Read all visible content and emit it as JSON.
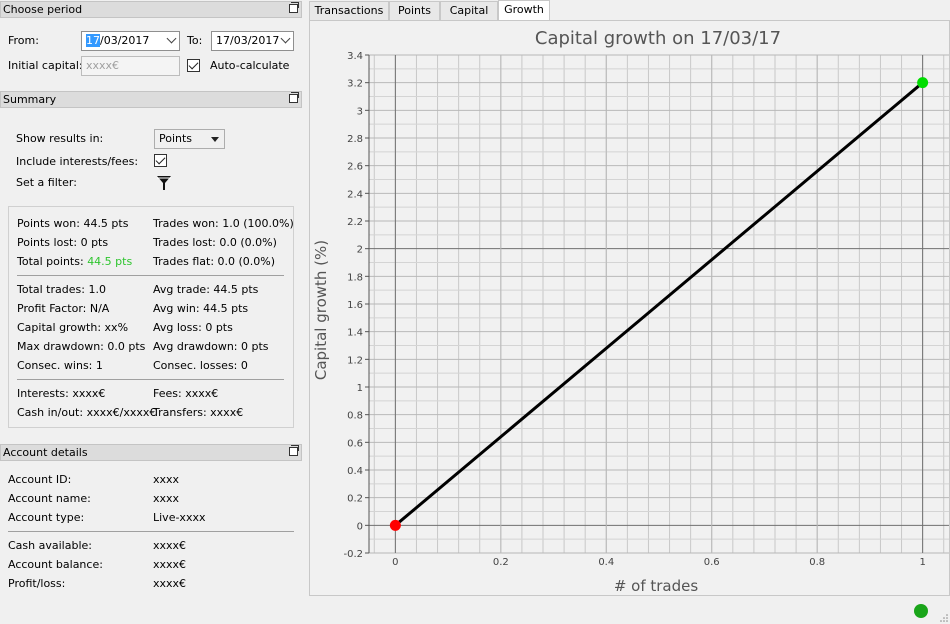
{
  "choose_period": {
    "header": "Choose period",
    "from_label": "From:",
    "from_value_day": "17",
    "from_value_rest": "/03/2017",
    "to_label": "To:",
    "to_value": "17/03/2017",
    "initial_capital_label": "Initial capital:",
    "initial_capital_placeholder": "xxxx€",
    "auto_calculate_label": "Auto-calculate",
    "auto_calculate_checked": true
  },
  "summary": {
    "header": "Summary",
    "show_results_label": "Show results in:",
    "show_results_value": "Points",
    "include_interests_label": "Include interests/fees:",
    "include_interests_checked": true,
    "filter_label": "Set a filter:",
    "stats_left": {
      "points_won": "Points won: 44.5 pts",
      "points_lost": "Points lost: 0 pts",
      "total_points_label": "Total points: ",
      "total_points_value": "44.5 pts",
      "total_trades": "Total trades: 1.0",
      "profit_factor": "Profit Factor: N/A",
      "capital_growth": "Capital growth: xx%",
      "max_drawdown": "Max drawdown: 0.0 pts",
      "consec_wins": "Consec. wins: 1",
      "interests": "Interests: xxxx€",
      "cash_in_out": "Cash in/out: xxxx€/xxxx€"
    },
    "stats_right": {
      "trades_won": "Trades won: 1.0 (100.0%)",
      "trades_lost": "Trades lost: 0.0 (0.0%)",
      "trades_flat": "Trades flat: 0.0 (0.0%)",
      "avg_trade": "Avg trade: 44.5 pts",
      "avg_win": "Avg win: 44.5 pts",
      "avg_loss": "Avg loss: 0 pts",
      "avg_drawdown": "Avg drawdown: 0 pts",
      "consec_losses": "Consec. losses: 0",
      "fees": "Fees: xxxx€",
      "transfers": "Transfers: xxxx€"
    },
    "positive_color": "#2ec52e"
  },
  "account_details": {
    "header": "Account details",
    "rows": [
      {
        "label": "Account ID:",
        "value": "xxxx"
      },
      {
        "label": "Account name:",
        "value": "xxxx"
      },
      {
        "label": "Account type:",
        "value": "Live-xxxx"
      },
      {
        "label": "Cash available:",
        "value": "xxxx€"
      },
      {
        "label": "Account balance:",
        "value": "xxxx€"
      },
      {
        "label": "Profit/loss:",
        "value": "xxxx€"
      }
    ]
  },
  "tabs": [
    {
      "label": "Transactions",
      "active": false
    },
    {
      "label": "Points",
      "active": false
    },
    {
      "label": "Capital",
      "active": false
    },
    {
      "label": "Growth",
      "active": true
    }
  ],
  "status": {
    "indicator_color": "#1aa51a"
  },
  "chart_data": {
    "type": "line",
    "title": "Capital growth on 17/03/17",
    "xlabel": "# of trades",
    "ylabel": "Capital growth (%)",
    "xlim": [
      -0.05,
      1.05
    ],
    "ylim": [
      -0.2,
      3.4
    ],
    "x_ticks": [
      0,
      0.2,
      0.4,
      0.6,
      0.8,
      1
    ],
    "x_tick_labels": [
      "0",
      "0.2",
      "0.4",
      "0.6",
      "0.8",
      "1"
    ],
    "y_ticks": [
      -0.2,
      0,
      0.2,
      0.4,
      0.6,
      0.8,
      1,
      1.2,
      1.4,
      1.6,
      1.8,
      2,
      2.2,
      2.4,
      2.6,
      2.8,
      3,
      3.2,
      3.4
    ],
    "y_tick_labels": [
      "-0.2",
      "0",
      "0.2",
      "0.4",
      "0.6",
      "0.8",
      "1",
      "1.2",
      "1.4",
      "1.6",
      "1.8",
      "2",
      "2.2",
      "2.4",
      "2.6",
      "2.8",
      "3",
      "3.2",
      "3.4"
    ],
    "grid": true,
    "series": [
      {
        "x": [
          0,
          1
        ],
        "y": [
          0,
          3.2
        ],
        "color": "#000000"
      }
    ],
    "markers": [
      {
        "x": 0,
        "y": 0,
        "color": "#ff0000"
      },
      {
        "x": 1,
        "y": 3.2,
        "color": "#00dd00"
      }
    ]
  }
}
